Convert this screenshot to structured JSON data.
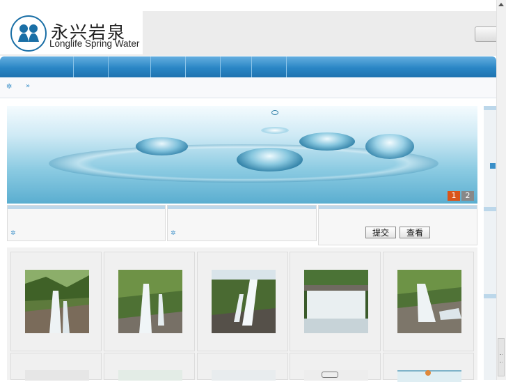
{
  "header": {
    "logo_cn": "永兴岩泉",
    "logo_en": "Longlife Spring Water"
  },
  "nav": {
    "item_count": 8
  },
  "breadcrumb": {
    "sep": "»"
  },
  "banner": {
    "slides": [
      "1",
      "2"
    ],
    "active_slide": "1"
  },
  "form": {
    "submit_label": "提交",
    "view_label": "查看"
  },
  "gallery": {
    "row1": [
      "waterfall-1",
      "waterfall-2",
      "waterfall-3",
      "waterfall-4",
      "waterfall-5"
    ],
    "row2": [
      "document-1",
      "document-2",
      "document-3",
      "document-4",
      "document-5"
    ]
  },
  "colors": {
    "nav_blue": "#2a86c5",
    "accent_orange": "#d9541a",
    "pager_grey": "#888888"
  }
}
